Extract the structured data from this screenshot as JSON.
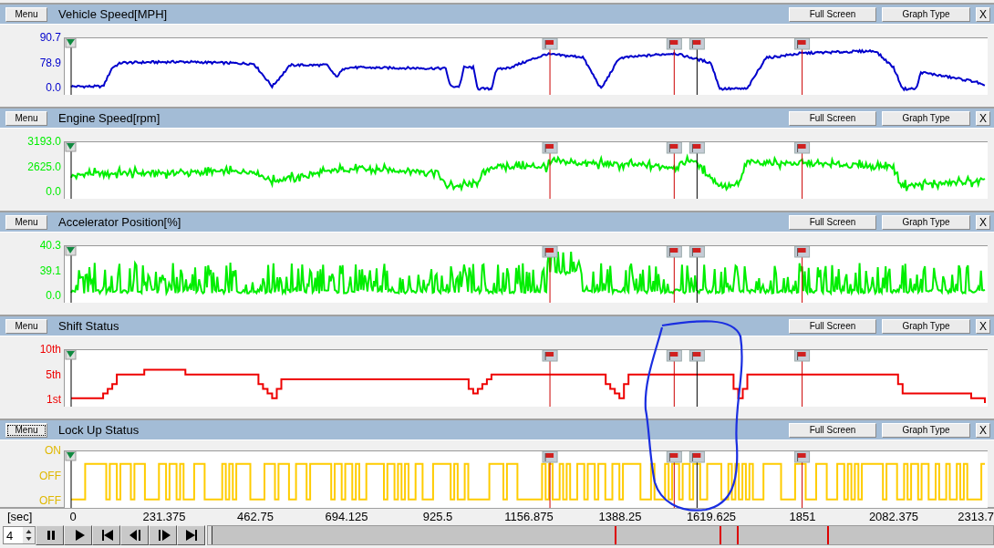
{
  "panels": [
    {
      "menu_label": "Menu",
      "menu_focused": false,
      "title": "Vehicle Speed[MPH]",
      "kind": "speed",
      "color": "#0000cc",
      "y_labels": [
        "90.7",
        "78.9",
        "0.0"
      ],
      "buttons": [
        "Full Screen",
        "Graph Type"
      ],
      "close_label": "X"
    },
    {
      "menu_label": "Menu",
      "menu_focused": false,
      "title": "Engine Speed[rpm]",
      "kind": "engine",
      "color": "#00ee00",
      "y_labels": [
        "3193.0",
        "2625.0",
        "0.0"
      ],
      "buttons": [
        "Full Screen",
        "Graph Type"
      ],
      "close_label": "X"
    },
    {
      "menu_label": "Menu",
      "menu_focused": false,
      "title": "Accelerator Position[%]",
      "kind": "spiky",
      "color": "#00ee00",
      "y_labels": [
        "40.3",
        "39.1",
        "0.0"
      ],
      "buttons": [
        "Full Screen",
        "Graph Type"
      ],
      "close_label": "X"
    },
    {
      "menu_label": "Menu",
      "menu_focused": false,
      "title": "Shift Status",
      "kind": "steps",
      "color": "#ee0000",
      "y_labels": [
        "10th",
        "5th",
        "1st"
      ],
      "buttons": [
        "Full Screen",
        "Graph Type"
      ],
      "close_label": "X"
    },
    {
      "menu_label": "Menu",
      "menu_focused": true,
      "title": "Lock Up Status",
      "kind": "square",
      "color": "#ffcc00",
      "y_labels": [
        "ON",
        "OFF",
        "OFF"
      ],
      "buttons": [
        "Full Screen",
        "Graph Type"
      ],
      "close_label": "X"
    }
  ],
  "time_axis": {
    "unit": "[sec]",
    "ticks": [
      "0",
      "231.375",
      "462.75",
      "694.125",
      "925.5",
      "1156.875",
      "1388.25",
      "1619.625",
      "1851",
      "2082.375",
      "2313.7"
    ]
  },
  "playback": {
    "speed": "4"
  }
}
